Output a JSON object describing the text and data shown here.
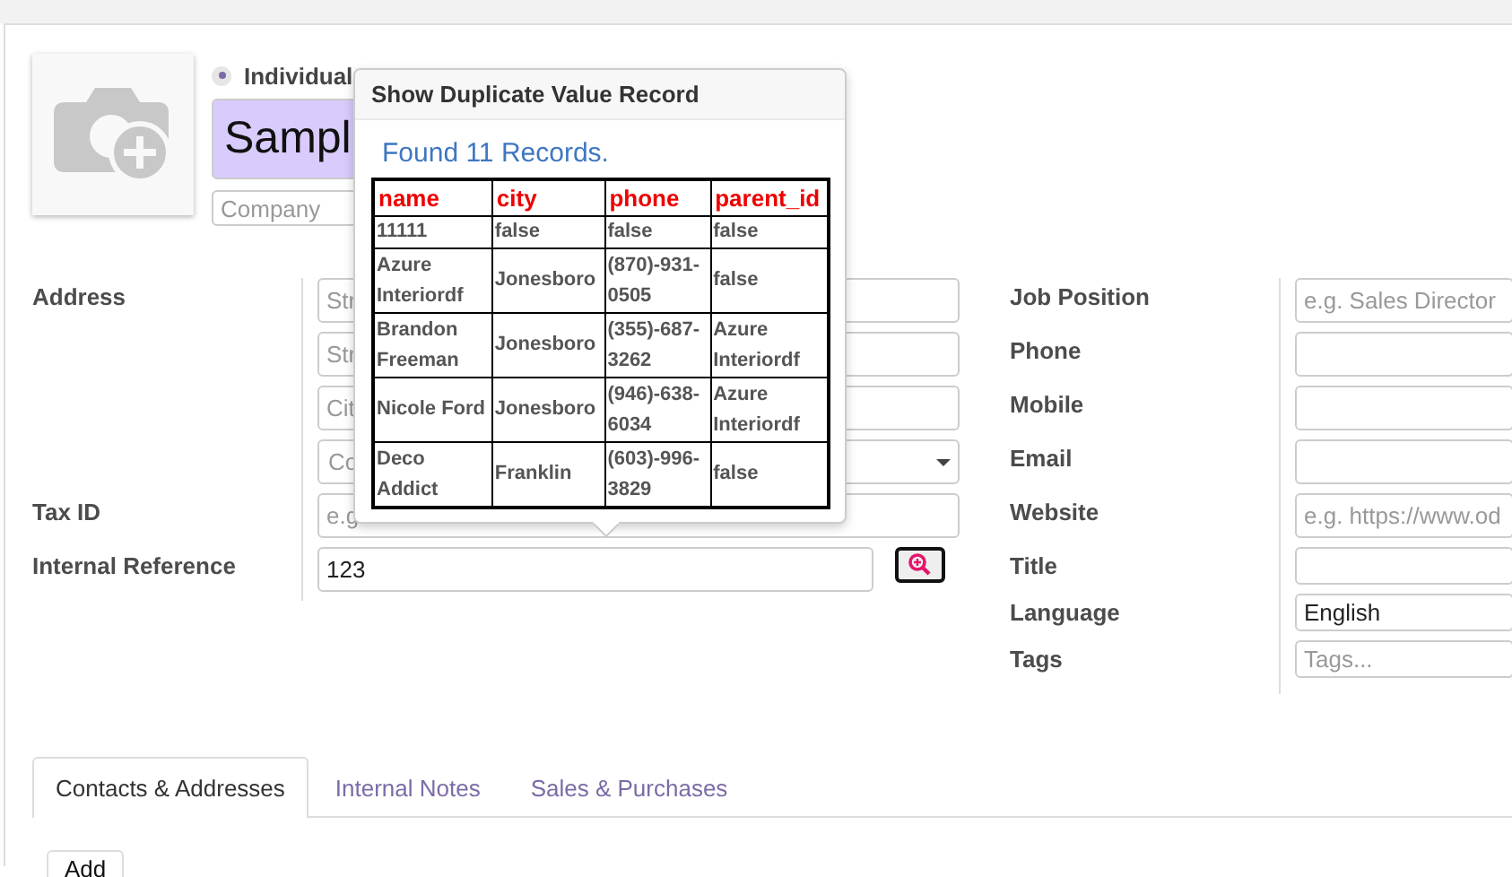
{
  "contact_type": [
    {
      "label": "Individual",
      "selected": true
    }
  ],
  "name_field": {
    "value": "Sampl"
  },
  "company_field": {
    "placeholder": "Company"
  },
  "left_rows": [
    {
      "label": "Address",
      "kind": "input",
      "placeholder": "Str"
    },
    {
      "kind": "input",
      "placeholder": "Str"
    },
    {
      "kind": "input",
      "placeholder": "Cit"
    },
    {
      "kind": "select",
      "placeholder": "Co"
    },
    {
      "label": "Tax ID",
      "kind": "input",
      "placeholder": "e.g"
    },
    {
      "label": "Internal Reference",
      "kind": "search",
      "value": "123"
    }
  ],
  "right_rows": [
    {
      "label": "Job Position",
      "kind": "input",
      "placeholder": "e.g. Sales Director"
    },
    {
      "label": "Phone",
      "kind": "input"
    },
    {
      "label": "Mobile",
      "kind": "input"
    },
    {
      "label": "Email",
      "kind": "input"
    },
    {
      "label": "Website",
      "kind": "input",
      "placeholder": "e.g. https://www.od"
    },
    {
      "label": "Title",
      "kind": "input"
    },
    {
      "label": "Language",
      "kind": "input",
      "value": "English"
    },
    {
      "label": "Tags",
      "kind": "input",
      "placeholder": "Tags..."
    }
  ],
  "popover": {
    "title": "Show Duplicate Value Record",
    "message": "Found 11 Records.",
    "columns": [
      "name",
      "city",
      "phone",
      "parent_id"
    ],
    "rows": [
      [
        "11111",
        "false",
        "false",
        "false"
      ],
      [
        "Azure Interiordf",
        "Jonesboro",
        "(870)-931-0505",
        "false"
      ],
      [
        "Brandon Freeman",
        "Jonesboro",
        "(355)-687-3262",
        "Azure Interiordf"
      ],
      [
        "Nicole Ford",
        "Jonesboro",
        "(946)-638-6034",
        "Azure Interiordf"
      ],
      [
        "Deco Addict",
        "Franklin",
        "(603)-996-3829",
        "false"
      ]
    ]
  },
  "tabs": [
    {
      "label": "Contacts & Addresses",
      "selected": true
    },
    {
      "label": "Internal Notes",
      "selected": false
    },
    {
      "label": "Sales & Purchases",
      "selected": false
    }
  ],
  "add_button": "Add"
}
